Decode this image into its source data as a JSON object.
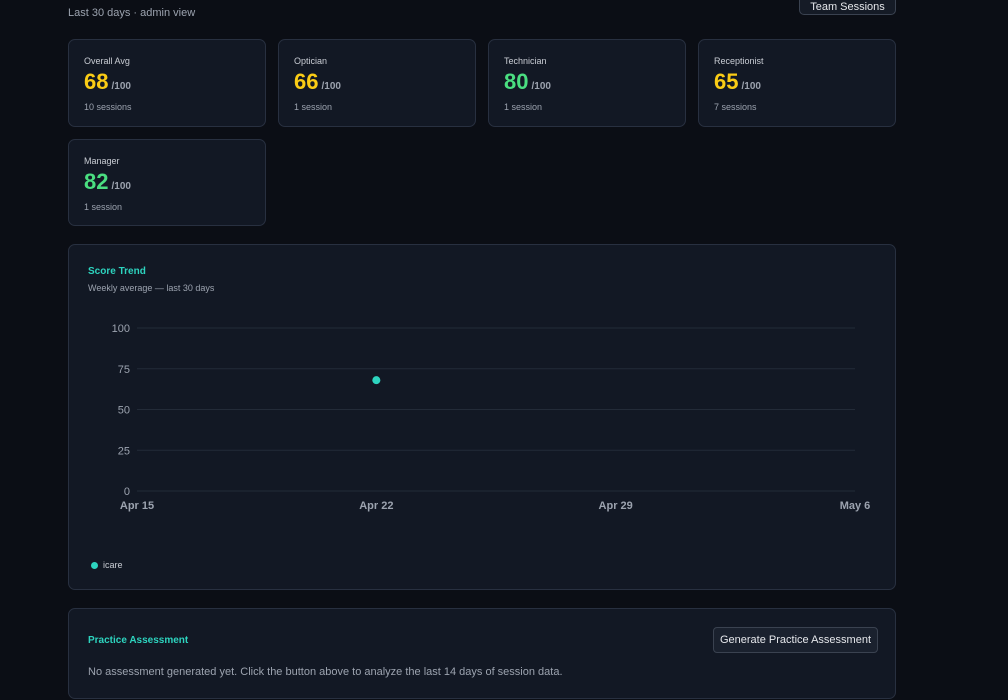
{
  "header": {
    "subtitle": "Last 30 days · admin view",
    "team_sessions_label": "Team Sessions"
  },
  "cards": [
    {
      "label": "Overall Avg",
      "score": "68",
      "denominator": "/100",
      "sessions": "10 sessions",
      "color": "#facc15"
    },
    {
      "label": "Optician",
      "score": "66",
      "denominator": "/100",
      "sessions": "1 session",
      "color": "#facc15"
    },
    {
      "label": "Technician",
      "score": "80",
      "denominator": "/100",
      "sessions": "1 session",
      "color": "#4ade80"
    },
    {
      "label": "Receptionist",
      "score": "65",
      "denominator": "/100",
      "sessions": "7 sessions",
      "color": "#facc15"
    },
    {
      "label": "Manager",
      "score": "82",
      "denominator": "/100",
      "sessions": "1 session",
      "color": "#4ade80"
    }
  ],
  "trend": {
    "title": "Score Trend",
    "subtitle": "Weekly average — last 30 days"
  },
  "chart_data": {
    "type": "scatter",
    "title": "Score Trend",
    "subtitle": "Weekly average — last 30 days",
    "x_ticks": [
      "Apr 15",
      "Apr 22",
      "Apr 29",
      "May 6"
    ],
    "y_ticks": [
      0,
      25,
      50,
      75,
      100
    ],
    "ylim": [
      0,
      100
    ],
    "grid": true,
    "legend_position": "bottom-left",
    "series": [
      {
        "name": "icare",
        "color": "#2dd4bf",
        "points": [
          {
            "x": "Apr 22",
            "y": 68
          }
        ]
      }
    ]
  },
  "assessment": {
    "title": "Practice Assessment",
    "button_label": "Generate Practice Assessment",
    "empty_text": "No assessment generated yet. Click the button above to analyze the last 14 days of session data."
  }
}
